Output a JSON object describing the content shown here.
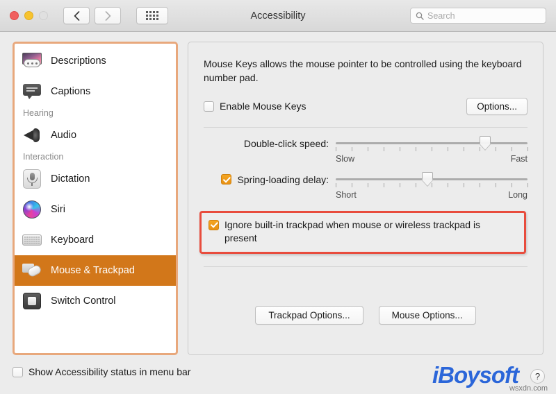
{
  "window": {
    "title": "Accessibility",
    "traffic_lights": [
      "close",
      "minimize",
      "zoom"
    ],
    "back_label": "Back",
    "forward_label": "Forward",
    "show_all_label": "Show All"
  },
  "search": {
    "placeholder": "Search",
    "value": ""
  },
  "sidebar": {
    "items": [
      {
        "type": "item",
        "label": "Descriptions",
        "icon": "descriptions-icon",
        "selected": false
      },
      {
        "type": "item",
        "label": "Captions",
        "icon": "captions-icon",
        "selected": false
      },
      {
        "type": "header",
        "label": "Hearing"
      },
      {
        "type": "item",
        "label": "Audio",
        "icon": "audio-icon",
        "selected": false
      },
      {
        "type": "header",
        "label": "Interaction"
      },
      {
        "type": "item",
        "label": "Dictation",
        "icon": "dictation-icon",
        "selected": false
      },
      {
        "type": "item",
        "label": "Siri",
        "icon": "siri-icon",
        "selected": false
      },
      {
        "type": "item",
        "label": "Keyboard",
        "icon": "keyboard-icon",
        "selected": false
      },
      {
        "type": "item",
        "label": "Mouse & Trackpad",
        "icon": "mouse-trackpad-icon",
        "selected": true
      },
      {
        "type": "item",
        "label": "Switch Control",
        "icon": "switch-control-icon",
        "selected": false
      }
    ]
  },
  "main": {
    "description": "Mouse Keys allows the mouse pointer to be controlled using the keyboard number pad.",
    "enable_mouse_keys": {
      "label": "Enable Mouse Keys",
      "checked": false
    },
    "options_button": "Options...",
    "double_click_speed": {
      "label": "Double-click speed:",
      "min_label": "Slow",
      "max_label": "Fast",
      "value_percent": 78,
      "tick_count": 13
    },
    "spring_loading_delay": {
      "label": "Spring-loading delay:",
      "checked": true,
      "min_label": "Short",
      "max_label": "Long",
      "value_percent": 48,
      "tick_count": 13
    },
    "ignore_trackpad": {
      "label": "Ignore built-in trackpad when mouse or wireless trackpad is present",
      "checked": true,
      "highlight_color": "#E84C3D"
    },
    "trackpad_options_button": "Trackpad Options...",
    "mouse_options_button": "Mouse Options..."
  },
  "footer": {
    "show_status": {
      "label": "Show Accessibility status in menu bar",
      "checked": false
    },
    "help_label": "?",
    "watermark": "iBoysoft",
    "source_text": "wsxdn.com"
  },
  "colors": {
    "selection_orange": "#D2771A",
    "sidebar_border_orange": "#E8A87C",
    "highlight_red": "#E84C3D",
    "checkbox_orange": "#F5A623",
    "brand_blue": "#2B66D9"
  }
}
